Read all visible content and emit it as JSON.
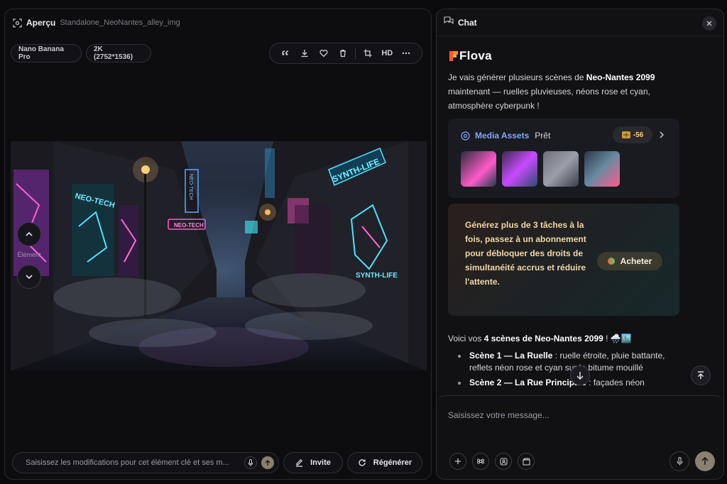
{
  "preview": {
    "title": "Aperçu",
    "filename": "Standalone_NeoNantes_alley_img",
    "model": "Nano Banana Pro",
    "resolution": "2K (2752*1536)",
    "toolbar": {
      "hd_label": "HD"
    },
    "element_label": "Élément",
    "image_signs": [
      "NEO-TECH",
      "NEO-TECH",
      "NEO-TECH",
      "SYNTH-LIFE",
      "SYNTH-LIFE"
    ],
    "edit_placeholder": "Saisissez les modifications pour cet élément clé et ses m...",
    "invite_label": "Invite",
    "regenerate_label": "Régénérer"
  },
  "chat": {
    "title": "Chat",
    "brand": "Flova",
    "intro_1": "Je vais générer plusieurs scènes de ",
    "intro_bold": "Neo-Nantes 2099",
    "intro_2": " maintenant — ruelles pluvieuses, néons rose et cyan, atmosphère cyberpunk !",
    "assets": {
      "title": "Media Assets",
      "status": "Prêt",
      "credits": "-56"
    },
    "promo": {
      "text": "Générez plus de 3 tâches à la fois, passez à un abonnement pour débloquer des droits de simultanéité accrus et réduire l'attente.",
      "button": "Acheter"
    },
    "scenes_intro_1": "Voici vos ",
    "scenes_intro_bold": "4 scènes de Neo-Nantes 2099",
    "scenes_intro_2": " ! 🌧️🏙️",
    "scenes": [
      {
        "title": "Scène 1 — La Ruelle",
        "desc": " : ruelle étroite, pluie battante, reflets néon rose et cyan sur le bitume mouillé"
      },
      {
        "title": "Scène 2 — La Rue Principale",
        "desc": " : façades néon"
      }
    ],
    "composer_placeholder": "Saisissez votre message..."
  },
  "colors": {
    "accent_blue": "#7fa7ff",
    "promo_text": "#f2d7a6",
    "credit": "#ffcf6e"
  }
}
